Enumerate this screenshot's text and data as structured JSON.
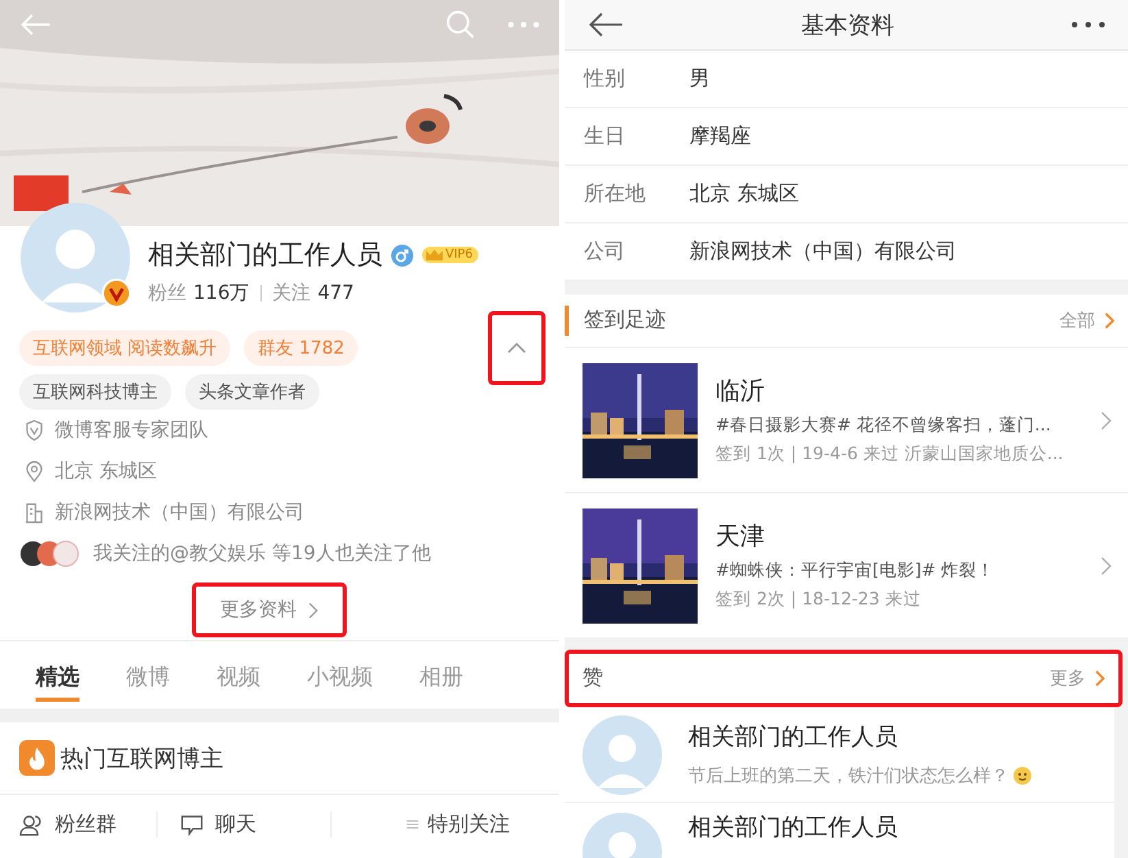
{
  "left": {
    "profile": {
      "name": "相关部门的工作人员",
      "vip": "VIP6",
      "stats": [
        {
          "label": "粉丝",
          "value": "116万"
        },
        {
          "label": "关注",
          "value": "477"
        }
      ],
      "hot_tags": [
        "互联网领域 阅读数飙升",
        "群友 1782"
      ],
      "tags": [
        "互联网科技博主",
        "头条文章作者"
      ],
      "info": [
        {
          "kind": "shield",
          "text": "微博客服专家团队"
        },
        {
          "kind": "pin",
          "text": "北京 东城区"
        },
        {
          "kind": "building",
          "text": "新浪网技术（中国）有限公司"
        }
      ],
      "mutual": "我关注的@教父娱乐 等19人也关注了他",
      "collapse": {
        "highlighted": true
      },
      "more": {
        "label": "更多资料",
        "highlighted": true
      }
    },
    "tabs": [
      {
        "label": "精选",
        "selected": true
      },
      {
        "label": "微博",
        "selected": false
      },
      {
        "label": "视频",
        "selected": false
      },
      {
        "label": "小视频",
        "selected": false
      },
      {
        "label": "相册",
        "selected": false
      }
    ],
    "section": {
      "title": "热门互联网博主"
    },
    "bottom_bar": [
      {
        "kind": "fans",
        "label": "粉丝群"
      },
      {
        "kind": "chat",
        "label": "聊天"
      },
      {
        "kind": "menu",
        "label": "特别关注"
      }
    ]
  },
  "right": {
    "title": "基本资料",
    "fields": [
      {
        "label": "性别",
        "value": "男"
      },
      {
        "label": "生日",
        "value": "摩羯座"
      },
      {
        "label": "所在地",
        "value": "北京 东城区"
      },
      {
        "label": "公司",
        "value": "新浪网技术（中国）有限公司"
      }
    ],
    "checkins": {
      "title": "签到足迹",
      "more": "全部",
      "items": [
        {
          "city": "临沂",
          "post": "#春日摄影大赛# 花径不曾缘客扫，蓬门...",
          "meta": "签到 1次 | 19-4-6 来过 沂蒙山国家地质公..."
        },
        {
          "city": "天津",
          "post": "#蜘蛛侠：平行宇宙[电影]# 炸裂！",
          "meta": "签到 2次 | 18-12-23 来过"
        }
      ]
    },
    "likes": {
      "title": "赞",
      "more": "更多",
      "highlighted": true,
      "items": [
        {
          "name": "相关部门的工作人员",
          "text": "节后上班的第二天，铁汁们状态怎么样？",
          "emoji": true
        },
        {
          "name": "相关部门的工作人员",
          "emoji": false
        }
      ]
    }
  }
}
